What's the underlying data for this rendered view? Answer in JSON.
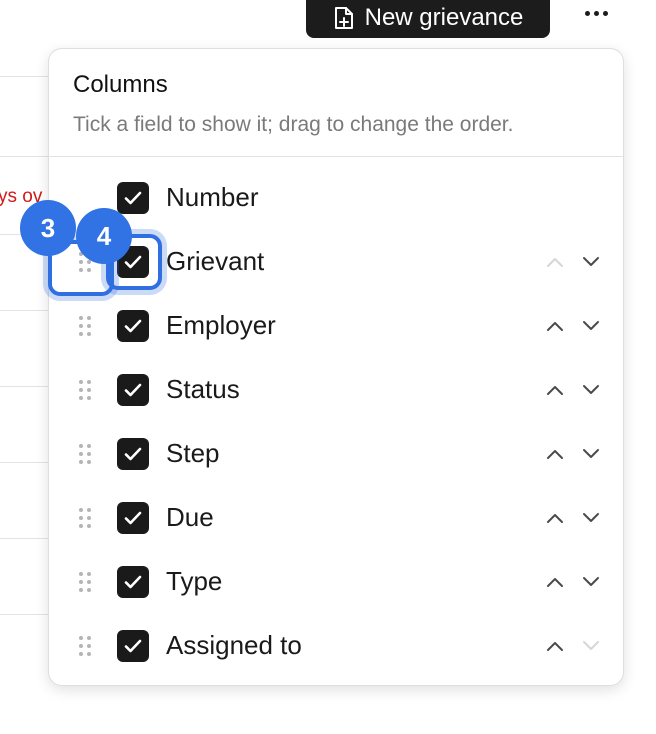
{
  "toolbar": {
    "new_label": "New grievance",
    "new_icon": "file-plus-icon",
    "more_icon": "more-horizontal-icon"
  },
  "background": {
    "overdue_fragment": "ys ov"
  },
  "panel": {
    "title": "Columns",
    "subtitle": "Tick a field to show it; drag to change the order.",
    "rows": [
      {
        "label": "Number",
        "checked": true,
        "has_handle": false,
        "has_arrows": false
      },
      {
        "label": "Grievant",
        "checked": true,
        "has_handle": true,
        "up_enabled": false,
        "down_enabled": true
      },
      {
        "label": "Employer",
        "checked": true,
        "has_handle": true,
        "up_enabled": true,
        "down_enabled": true
      },
      {
        "label": "Status",
        "checked": true,
        "has_handle": true,
        "up_enabled": true,
        "down_enabled": true
      },
      {
        "label": "Step",
        "checked": true,
        "has_handle": true,
        "up_enabled": true,
        "down_enabled": true
      },
      {
        "label": "Due",
        "checked": true,
        "has_handle": true,
        "up_enabled": true,
        "down_enabled": true
      },
      {
        "label": "Type",
        "checked": true,
        "has_handle": true,
        "up_enabled": true,
        "down_enabled": true
      },
      {
        "label": "Assigned to",
        "checked": true,
        "has_handle": true,
        "up_enabled": true,
        "down_enabled": false
      }
    ]
  },
  "annotations": {
    "badge_a": "3",
    "badge_b": "4"
  },
  "colors": {
    "accent": "#3173e4",
    "checkbox": "#1a1a1a",
    "overdue": "#d11a1a",
    "muted": "#7a7a7a"
  }
}
